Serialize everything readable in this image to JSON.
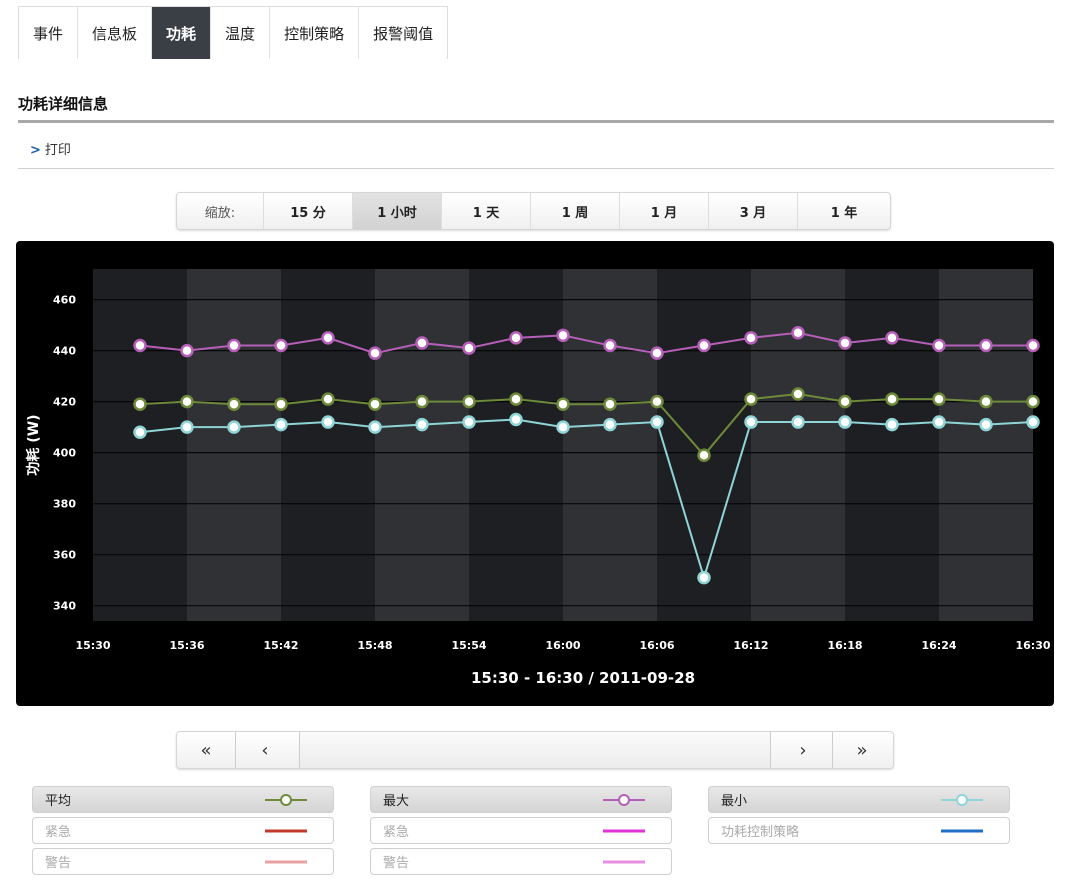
{
  "tabs": [
    {
      "label": "事件",
      "active": false
    },
    {
      "label": "信息板",
      "active": false
    },
    {
      "label": "功耗",
      "active": true
    },
    {
      "label": "温度",
      "active": false
    },
    {
      "label": "控制策略",
      "active": false
    },
    {
      "label": "报警阈值",
      "active": false
    }
  ],
  "section": {
    "title": "功耗详细信息",
    "print_label": "打印",
    "print_chevron": ">"
  },
  "zoom": {
    "label": "缩放:",
    "options": [
      "15 分",
      "1 小时",
      "1 天",
      "1 周",
      "1 月",
      "3 月",
      "1 年"
    ],
    "selected": "1 小时"
  },
  "navigation": {
    "first": "«",
    "prev": "‹",
    "next": "›",
    "last": "»"
  },
  "chart_data": {
    "type": "line",
    "title": "",
    "xlabel": "15:30 - 16:30 / 2011-09-28",
    "ylabel": "功耗 (W)",
    "ylim": [
      334,
      472
    ],
    "yticks": [
      340,
      360,
      380,
      400,
      420,
      440,
      460
    ],
    "xticks": [
      "15:30",
      "15:36",
      "15:42",
      "15:48",
      "15:54",
      "16:00",
      "16:06",
      "16:12",
      "16:18",
      "16:24",
      "16:30"
    ],
    "x_start": "15:30",
    "x_end": "16:30",
    "grid": true,
    "x": [
      "15:33",
      "15:36",
      "15:39",
      "15:42",
      "15:45",
      "15:48",
      "15:51",
      "15:54",
      "15:57",
      "16:00",
      "16:03",
      "16:06",
      "16:09",
      "16:12",
      "16:15",
      "16:18",
      "16:21",
      "16:24",
      "16:27",
      "16:30"
    ],
    "series": [
      {
        "name": "平均",
        "color": "#6e8a3a",
        "values": [
          419,
          420,
          419,
          419,
          421,
          419,
          420,
          420,
          421,
          419,
          419,
          420,
          399,
          421,
          423,
          420,
          421,
          421,
          420,
          420
        ]
      },
      {
        "name": "最大",
        "color": "#b65fb8",
        "values": [
          442,
          440,
          442,
          442,
          445,
          439,
          443,
          441,
          445,
          446,
          442,
          439,
          442,
          445,
          447,
          443,
          445,
          442,
          442,
          442
        ]
      },
      {
        "name": "最小",
        "color": "#8fd4d6",
        "values": [
          408,
          410,
          410,
          411,
          412,
          410,
          411,
          412,
          413,
          410,
          411,
          412,
          351,
          412,
          412,
          412,
          411,
          412,
          411,
          412
        ]
      }
    ]
  },
  "legend": {
    "columns": [
      [
        {
          "label": "平均",
          "color": "#6e8a3a",
          "marker": true,
          "on": true
        },
        {
          "label": "紧急",
          "color": "#c0392b",
          "marker": false,
          "on": false
        },
        {
          "label": "警告",
          "color": "#e8a2a2",
          "marker": false,
          "on": false
        }
      ],
      [
        {
          "label": "最大",
          "color": "#b65fb8",
          "marker": true,
          "on": true
        },
        {
          "label": "紧急",
          "color": "#e233d5",
          "marker": false,
          "on": false
        },
        {
          "label": "警告",
          "color": "#e88ee0",
          "marker": false,
          "on": false
        }
      ],
      [
        {
          "label": "最小",
          "color": "#8fd4d6",
          "marker": true,
          "on": true
        },
        {
          "label": "功耗控制策略",
          "color": "#1f6fc4",
          "marker": false,
          "on": false
        }
      ]
    ]
  }
}
